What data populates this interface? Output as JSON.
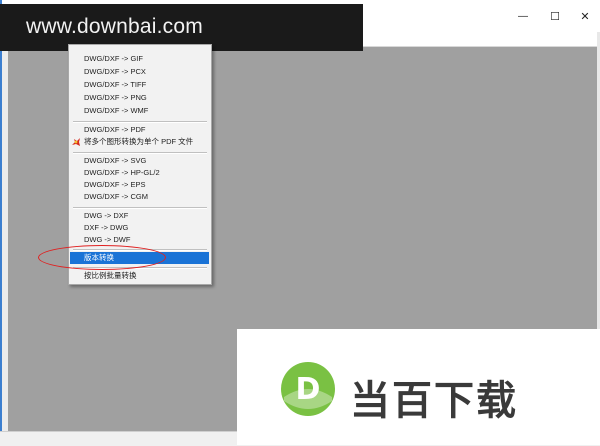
{
  "watermark": {
    "site": "www.downbai.com"
  },
  "window_controls": {
    "minimize": "—",
    "maximize": "☐",
    "close": "✕"
  },
  "menu": {
    "items": [
      {
        "label": "DWG/DXF -> GIF"
      },
      {
        "label": "DWG/DXF -> PCX"
      },
      {
        "label": "DWG/DXF -> TIFF"
      },
      {
        "label": "DWG/DXF -> PNG"
      },
      {
        "label": "DWG/DXF -> WMF"
      },
      {
        "label": "DWG/DXF -> PDF"
      },
      {
        "label": "将多个图形转换为单个 PDF 文件",
        "icon": "pdf-icon"
      },
      {
        "label": "DWG/DXF -> SVG"
      },
      {
        "label": "DWG/DXF -> HP-GL/2"
      },
      {
        "label": "DWG/DXF -> EPS"
      },
      {
        "label": "DWG/DXF -> CGM"
      },
      {
        "label": "DWG -> DXF"
      },
      {
        "label": "DXF -> DWG"
      },
      {
        "label": "DWG -> DWF"
      },
      {
        "label": "版本转换",
        "selected": true
      },
      {
        "label": "按比例批量转换"
      }
    ]
  },
  "logo": {
    "text": "当百下载",
    "letter": "D"
  },
  "colors": {
    "accent": "#1a73d6",
    "annotation": "#e02020",
    "logo_green": "#7ac143"
  }
}
